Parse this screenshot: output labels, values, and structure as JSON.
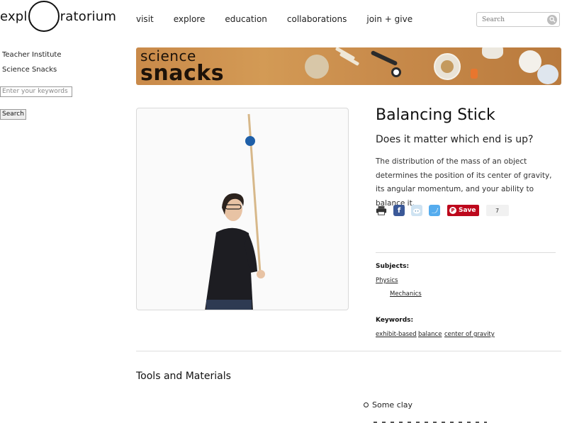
{
  "header": {
    "logo_left": "expl",
    "logo_right": "ratorium",
    "nav": [
      "visit",
      "explore",
      "education",
      "collaborations",
      "join + give"
    ],
    "search_placeholder": "Search"
  },
  "sidebar": {
    "links": [
      "Teacher Institute",
      "Science Snacks"
    ],
    "search_placeholder": "Enter your keywords",
    "search_button": "Search"
  },
  "banner": {
    "line1": "science",
    "line2": "snacks"
  },
  "snack": {
    "title": "Balancing Stick",
    "subtitle": "Does it matter which end is up?",
    "description": "The distribution of the mass of an object determines the position of its center of gravity, its angular momentum, and your ability to balance it.",
    "share": {
      "save_label": "Save",
      "save_count": "7"
    },
    "subjects_label": "Subjects:",
    "subjects": [
      "Physics",
      "Mechanics"
    ],
    "keywords_label": "Keywords:",
    "keywords": [
      "exhibit-based",
      "balance",
      "center of gravity"
    ]
  },
  "tools": {
    "heading": "Tools and Materials",
    "items": [
      "Some clay"
    ]
  },
  "colors": {
    "pinterest": "#bd081c",
    "facebook": "#3b5998",
    "twitter": "#55acee",
    "banner_wood": "#c98a4a"
  }
}
